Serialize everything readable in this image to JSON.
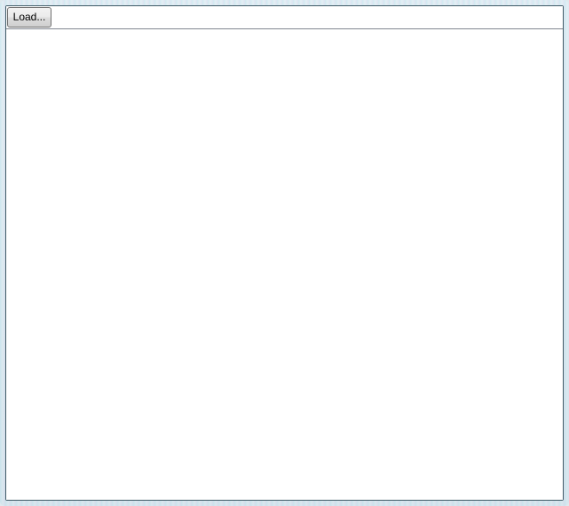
{
  "toolbar": {
    "load_label": "Load..."
  }
}
